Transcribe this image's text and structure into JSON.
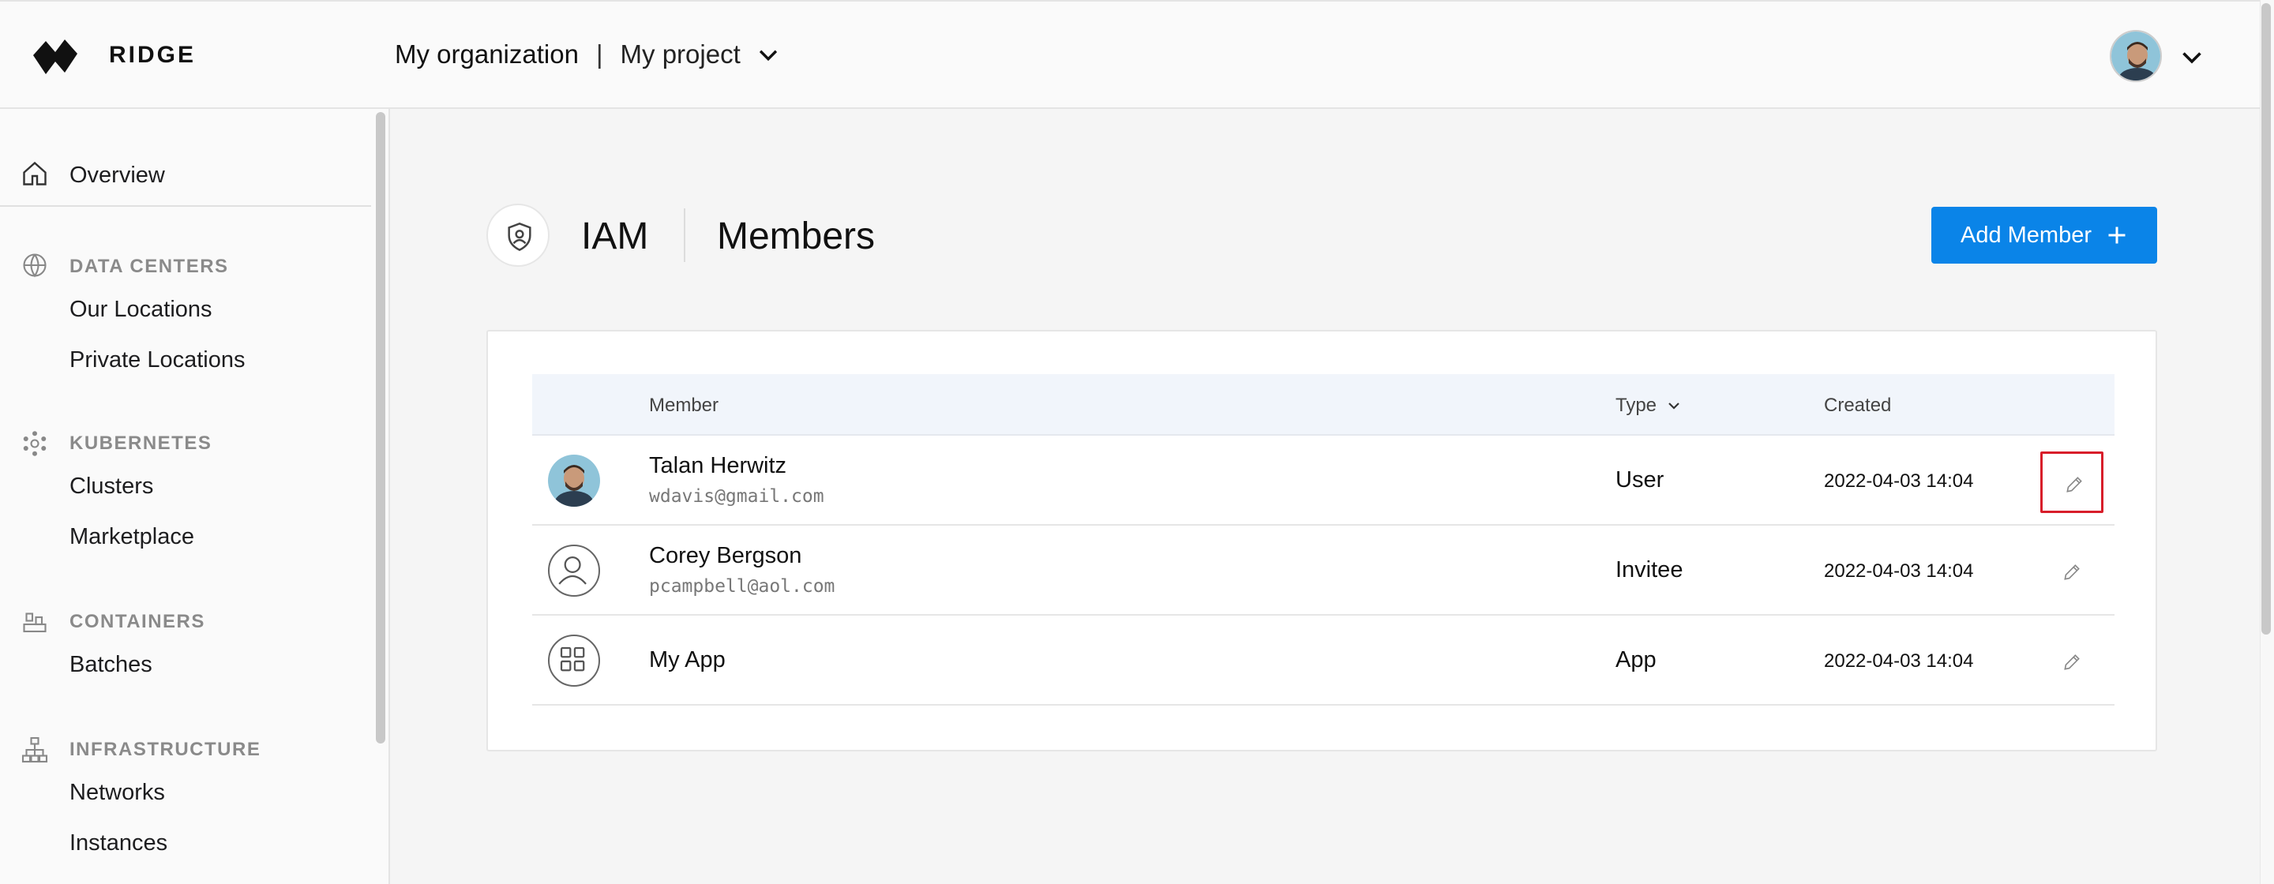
{
  "app": {
    "brand": "RIDGE",
    "accent": "#0a84e8",
    "highlight": "#d81e2a"
  },
  "header": {
    "organization": "My organization",
    "separator": "|",
    "project": "My project"
  },
  "sidebar": {
    "overview": "Overview",
    "sections": [
      {
        "title": "DATA CENTERS",
        "icon": "globe-icon",
        "items": [
          "Our Locations",
          "Private Locations"
        ]
      },
      {
        "title": "KUBERNETES",
        "icon": "kubernetes-icon",
        "items": [
          "Clusters",
          "Marketplace"
        ]
      },
      {
        "title": "CONTAINERS",
        "icon": "containers-icon",
        "items": [
          "Batches"
        ]
      },
      {
        "title": "INFRASTRUCTURE",
        "icon": "network-icon",
        "items": [
          "Networks",
          "Instances"
        ]
      }
    ]
  },
  "page": {
    "section": "IAM",
    "title": "Members",
    "add_button": "Add Member"
  },
  "table": {
    "columns": {
      "member": "Member",
      "type": "Type",
      "created": "Created"
    },
    "rows": [
      {
        "name": "Talan Herwitz",
        "email": "wdavis@gmail.com",
        "type": "User",
        "created": "2022-04-03 14:04",
        "avatar": "photo-avatar"
      },
      {
        "name": "Corey Bergson",
        "email": "pcampbell@aol.com",
        "type": "Invitee",
        "created": "2022-04-03 14:04",
        "avatar": "person-icon"
      },
      {
        "name": "My App",
        "email": "",
        "type": "App",
        "created": "2022-04-03 14:04",
        "avatar": "app-grid-icon"
      }
    ]
  }
}
